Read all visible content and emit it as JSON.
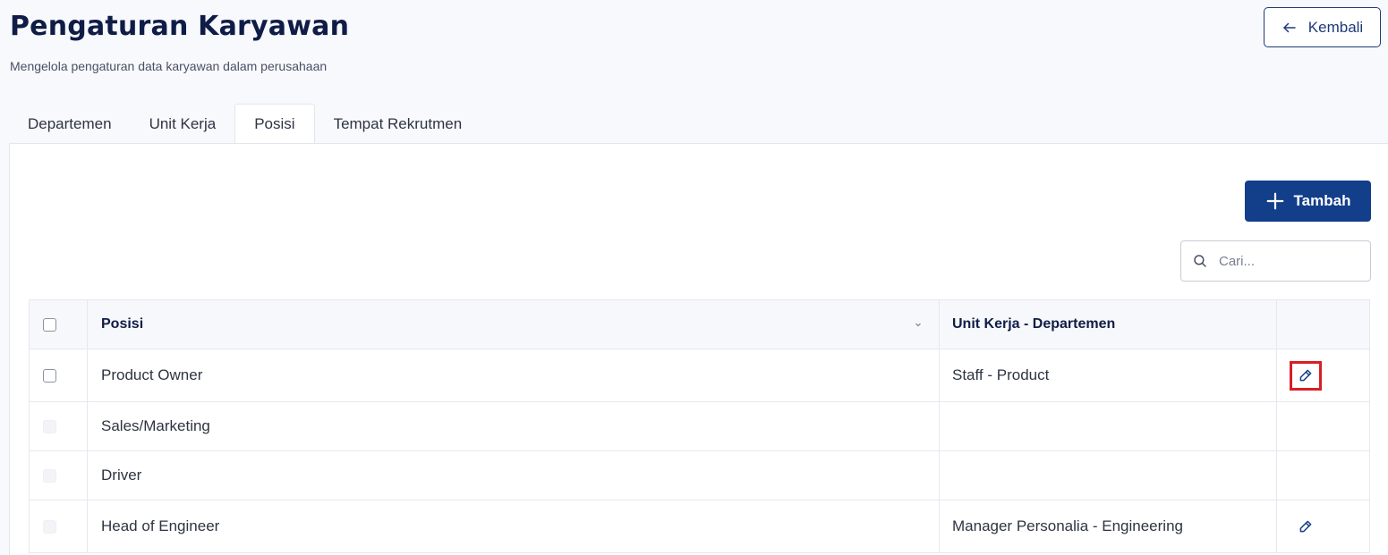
{
  "header": {
    "title": "Pengaturan Karyawan",
    "subtitle": "Mengelola pengaturan data karyawan dalam perusahaan",
    "back_label": "Kembali"
  },
  "tabs": [
    {
      "label": "Departemen",
      "active": false
    },
    {
      "label": "Unit Kerja",
      "active": false
    },
    {
      "label": "Posisi",
      "active": true
    },
    {
      "label": "Tempat Rekrutmen",
      "active": false
    }
  ],
  "toolbar": {
    "add_label": "Tambah",
    "search_placeholder": "Cari..."
  },
  "table": {
    "columns": [
      "Posisi",
      "Unit Kerja - Departemen"
    ],
    "rows": [
      {
        "posisi": "Product Owner",
        "unit": "Staff - Product",
        "editable": true,
        "highlighted": true
      },
      {
        "posisi": "Sales/Marketing",
        "unit": "",
        "editable": false
      },
      {
        "posisi": "Driver",
        "unit": "",
        "editable": false
      },
      {
        "posisi": "Head of Engineer",
        "unit": "Manager Personalia - Engineering",
        "editable": true
      }
    ]
  },
  "colors": {
    "primary": "#123e8a",
    "title": "#0f1d46",
    "highlight": "#d81f26"
  },
  "icons": {
    "back": "arrow-left-icon",
    "add": "plus-icon",
    "search": "search-icon",
    "sort": "chevron-down-icon",
    "edit": "pencil-icon"
  }
}
